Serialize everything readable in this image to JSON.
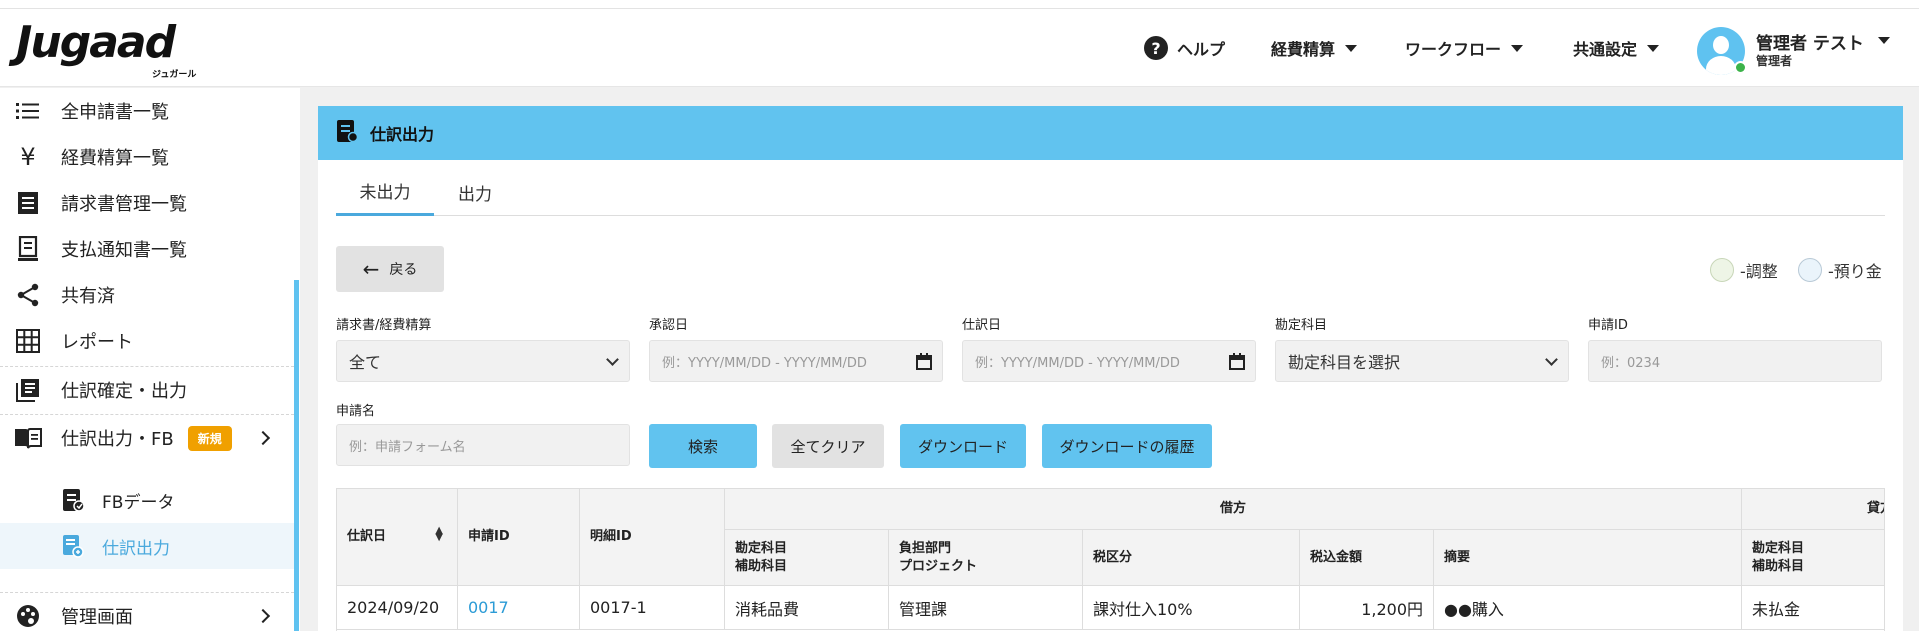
{
  "header": {
    "logo_text": "Jugaad",
    "logo_sub": "ジュガール",
    "help_label": "ヘルプ",
    "menus": [
      "経費精算",
      "ワークフロー",
      "共通設定"
    ],
    "user_name": "管理者 テスト",
    "user_role": "管理者"
  },
  "sidebar": {
    "items": [
      {
        "label": "全申請書一覧",
        "icon": "list-icon"
      },
      {
        "label": "経費精算一覧",
        "icon": "yen-icon"
      },
      {
        "label": "請求書管理一覧",
        "icon": "invoice-icon"
      },
      {
        "label": "支払通知書一覧",
        "icon": "receipt-icon"
      },
      {
        "label": "共有済",
        "icon": "share-icon"
      },
      {
        "label": "レポート",
        "icon": "grid-icon"
      },
      {
        "label": "仕訳確定・出力",
        "icon": "library-icon"
      },
      {
        "label": "仕訳出力・FB",
        "icon": "book-icon",
        "badge": "新規"
      },
      {
        "label": "FBデータ",
        "icon": "fb-data-icon"
      },
      {
        "label": "仕訳出力",
        "icon": "journal-output-icon"
      },
      {
        "label": "管理画面",
        "icon": "palette-icon"
      }
    ]
  },
  "page": {
    "title": "仕訳出力",
    "tabs": [
      "未出力",
      "出力"
    ],
    "back_label": "戻る",
    "legend": [
      {
        "label": "-調整",
        "color": "#eef5e6"
      },
      {
        "label": "-預り金",
        "color": "#eaf4fb"
      }
    ]
  },
  "filters": {
    "type": {
      "label": "請求書/経費精算",
      "value": "全て"
    },
    "approval_date": {
      "label": "承認日",
      "placeholder": "例：YYYY/MM/DD - YYYY/MM/DD"
    },
    "journal_date": {
      "label": "仕訳日",
      "placeholder": "例：YYYY/MM/DD - YYYY/MM/DD"
    },
    "account": {
      "label": "勘定科目",
      "value": "勘定科目を選択"
    },
    "request_id": {
      "label": "申請ID",
      "placeholder": "例：0234"
    },
    "request_name": {
      "label": "申請名",
      "placeholder": "例：申請フォーム名"
    }
  },
  "buttons": {
    "search": "検索",
    "clear_all": "全てクリア",
    "download": "ダウンロード",
    "download_history": "ダウンロードの履歴"
  },
  "table": {
    "headers": {
      "journal_date": "仕訳日",
      "request_id": "申請ID",
      "detail_id": "明細ID",
      "debit": "借方",
      "credit": "貸方",
      "account": "勘定科目",
      "sub_account": "補助科目",
      "dept": "負担部門",
      "project": "プロジェクト",
      "tax_category": "税区分",
      "tax_incl_amount": "税込金額",
      "summary": "摘要",
      "credit_account": "勘定科目",
      "credit_sub_account": "補助科目"
    },
    "rows": [
      {
        "journal_date": "2024/09/20",
        "request_id": "0017",
        "detail_id": "0017-1",
        "account": "消耗品費",
        "dept": "管理課",
        "tax_category": "課対仕入10%",
        "amount": "1,200円",
        "summary": "●●購入",
        "credit_account": "未払金"
      }
    ]
  }
}
